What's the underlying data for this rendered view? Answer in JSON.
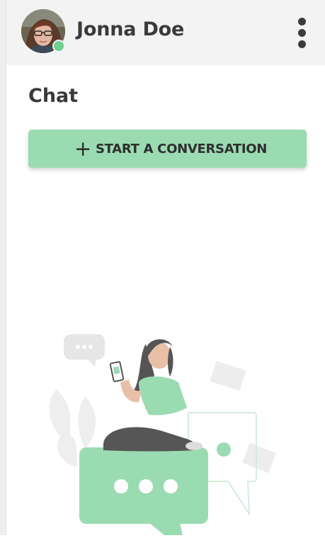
{
  "header": {
    "user_name": "Jonna Doe",
    "online_status_color": "#6fcf8f",
    "menu_icon": "more-vertical-icon"
  },
  "main": {
    "title": "Chat",
    "start_button": {
      "icon": "plus-icon",
      "plus_glyph": "+",
      "label": "START A CONVERSATION"
    }
  },
  "colors": {
    "accent": "#9bdbb2",
    "header_bg": "#f3f3f3",
    "text": "#3a3a3a"
  }
}
